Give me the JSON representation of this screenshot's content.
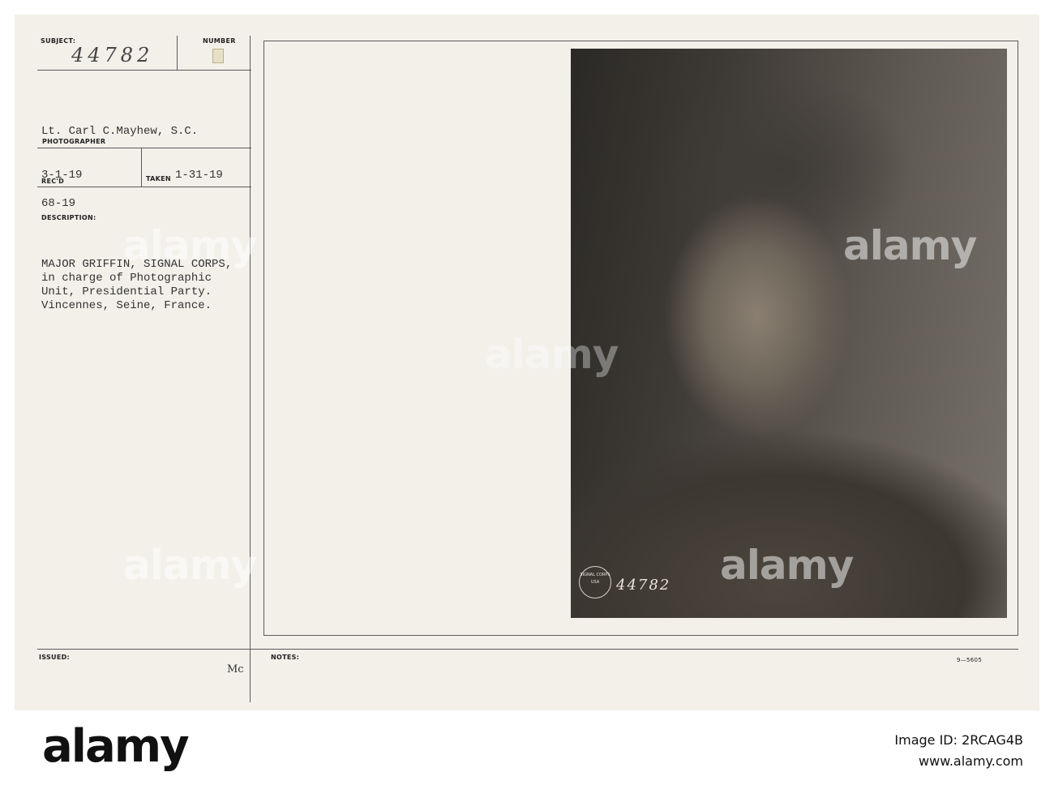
{
  "card": {
    "subject_label": "SUBJECT:",
    "number_label": "NUMBER",
    "subject_number": "44782",
    "photographer": "Lt. Carl C.Mayhew, S.C.",
    "photographer_label": "PHOTOGRAPHER",
    "received_date": "3-1-19",
    "received_label": "REC'D",
    "taken_label": "TAKEN",
    "taken_date": "1-31-19",
    "code": "68-19",
    "description_label": "DESCRIPTION:",
    "description_lines": [
      "MAJOR GRIFFIN, SIGNAL CORPS,",
      "in charge of Photographic",
      "Unit, Presidential Party.",
      "Vincennes, Seine, France."
    ],
    "issued_label": "ISSUED:",
    "issued_initials": "Mc",
    "notes_label": "NOTES:",
    "form_number": "9—5605"
  },
  "photo": {
    "stamp_text": "SIGNAL CORPS USA",
    "handwritten_number": "44782"
  },
  "watermark_text": "alamy",
  "footer": {
    "brand": "alamy",
    "image_id_label": "Image ID: 2RCAG4B",
    "site": "www.alamy.com"
  }
}
